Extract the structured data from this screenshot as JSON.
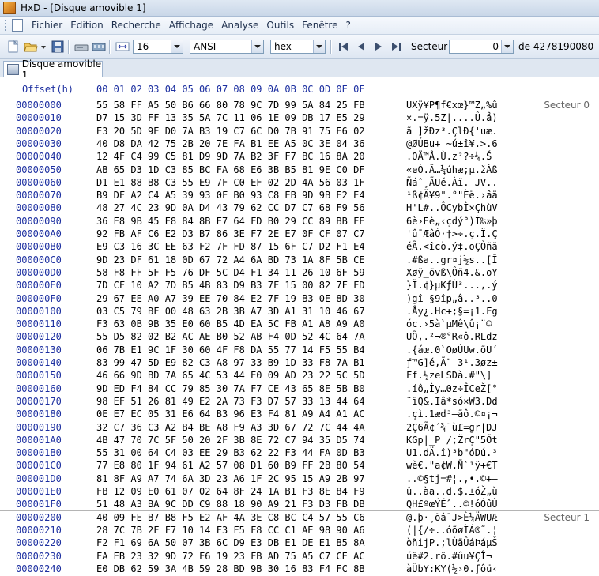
{
  "window": {
    "title": "HxD - [Disque amovible 1]"
  },
  "menu": [
    "Fichier",
    "Edition",
    "Recherche",
    "Affichage",
    "Analyse",
    "Outils",
    "Fenêtre",
    "?"
  ],
  "toolbar": {
    "bytes_per_row": "16",
    "charset": "ANSI",
    "offset_base": "hex",
    "sector_label": "Secteur",
    "sector_value": "0",
    "sector_total": "de 4278190080"
  },
  "tabs": [
    {
      "label": "Disque amovible 1"
    }
  ],
  "hex_header": {
    "offset_label": "Offset(h)",
    "columns": "00 01 02 03 04 05 06 07 08 09 0A 0B 0C 0D 0E 0F"
  },
  "sectors": [
    "Secteur 0",
    "Secteur 1"
  ],
  "rows": [
    {
      "o": "00000000",
      "h": "55 58 FF A5 50 B6 66 80 78 9C 7D 99 5A 84 25 FB",
      "a": "UXÿ¥P¶f€xœ}™Z„%û"
    },
    {
      "o": "00000010",
      "h": "D7 15 3D FF 13 35 5A 7C 11 06 1E 09 DB 17 E5 29",
      "a": "×.=ÿ.5Z|....Û.å)"
    },
    {
      "o": "00000020",
      "h": "E3 20 5D 9E D0 7A B3 19 C7 6C D0 7B 91 75 E6 02",
      "a": "ã ]žÐz³.ÇlÐ{'uæ."
    },
    {
      "o": "00000030",
      "h": "40 D8 DA 42 75 2B 20 7E FA B1 EE A5 0C 3E 04 36",
      "a": "@ØÚBu+ ~ú±î¥.>.6"
    },
    {
      "o": "00000040",
      "h": "12 4F C4 99 C5 81 D9 9D 7A B2 3F F7 BC 16 8A 20",
      "a": ".OÄ™Å.Ù.z²?÷¼.Š "
    },
    {
      "o": "00000050",
      "h": "AB 65 D3 1D C3 85 BC FA 68 E6 3B B5 81 9E C0 DF",
      "a": "«eÓ.Ã…¼úhæ;µ.žÀß"
    },
    {
      "o": "00000060",
      "h": "D1 E1 88 B8 C3 55 E9 7F C0 EF 02 2D 4A 56 03 1F",
      "a": "Ñáˆ¸ÃUé.Àï.-JV.."
    },
    {
      "o": "00000070",
      "h": "B9 DF A2 C4 A5 39 93 0F B0 93 C8 EB 9D 9B E2 E4",
      "a": "¹ß¢Ä¥9\".°\"Èë.›âä"
    },
    {
      "o": "00000080",
      "h": "48 27 4C 23 9D 0A D4 43 79 62 CC D7 C7 68 F9 56",
      "a": "H'L#..ÔCybÌ×ÇhùV"
    },
    {
      "o": "00000090",
      "h": "36 E8 9B 45 E8 84 8B E7 64 FD B0 29 CC 89 BB FE",
      "a": "6è›Eè„‹çdý°)Ì‰»þ"
    },
    {
      "o": "000000A0",
      "h": "92 FB AF C6 E2 D3 B7 86 3E F7 2E E7 0F CF 07 C7",
      "a": "'û¯ÆâÓ·†>÷.ç.Ï.Ç"
    },
    {
      "o": "000000B0",
      "h": "E9 C3 16 3C EE 63 F2 7F FD 87 15 6F C7 D2 F1 E4",
      "a": "éÃ.<îcò.ý‡.oÇÒñä"
    },
    {
      "o": "000000C0",
      "h": "9D 23 DF 61 18 0D 67 72 A4 6A BD 73 1A 8F 5B CE",
      "a": ".#ßa..gr¤j½s..[Î"
    },
    {
      "o": "000000D0",
      "h": "58 F8 FF 5F F5 76 DF 5C D4 F1 34 11 26 10 6F 59",
      "a": "Xøÿ_õvß\\Ôñ4.&.oY"
    },
    {
      "o": "000000E0",
      "h": "7D CF 10 A2 7D B5 4B 83 D9 B3 7F 15 00 82 7F FD",
      "a": "}Ï.¢}µKƒÙ³...‚.ý"
    },
    {
      "o": "000000F0",
      "h": "29 67 EE A0 A7 39 EE 70 84 E2 7F 19 B3 0E 8D 30",
      "a": ")gî §9îp„â..³..0"
    },
    {
      "o": "00000100",
      "h": "03 C5 79 BF 00 48 63 2B 3B A7 3D A1 31 10 46 67",
      "a": ".Åy¿.Hc+;§=¡1.Fg"
    },
    {
      "o": "00000110",
      "h": "F3 63 0B 9B 35 E0 60 B5 4D EA 5C FB A1 A8 A9 A0",
      "a": "óc.›5à`µMê\\û¡¨© "
    },
    {
      "o": "00000120",
      "h": "55 D5 82 02 B2 AC AE B0 52 AB F4 0D 52 4C 64 7A",
      "a": "UÕ‚.²¬®°R«ô.RLdz"
    },
    {
      "o": "00000130",
      "h": "06 7B E1 9C 1F 30 60 4F F8 DA 55 77 14 F5 55 B4",
      "a": ".{áœ.0`OøÚUw.õU´"
    },
    {
      "o": "00000140",
      "h": "83 99 47 5D E9 82 C3 A8 97 33 B9 1D 33 F8 7A B1",
      "a": "ƒ™G]é‚Ã¨—3¹.3øz±"
    },
    {
      "o": "00000150",
      "h": "46 66 9D BD 7A 65 4C 53 44 E0 09 AD 23 22 5C 5D",
      "a": "Ff.½zeLSDà.­#\"\\]"
    },
    {
      "o": "00000160",
      "h": "9D ED F4 84 CC 79 85 30 7A F7 CE 43 65 8E 5B B0",
      "a": ".íô„Ìy…0z÷ÎCeŽ[°"
    },
    {
      "o": "00000170",
      "h": "98 EF 51 26 81 49 E2 2A 73 F3 D7 57 33 13 44 64",
      "a": "˜ïQ&.Iâ*só×W3.Dd"
    },
    {
      "o": "00000180",
      "h": "0E E7 EC 05 31 E6 64 B3 96 E3 F4 81 A9 A4 A1 AC",
      "a": ".çì.1æd³–ãô.©¤¡¬"
    },
    {
      "o": "00000190",
      "h": "32 C7 36 C3 A2 B4 BE A8 F9 A3 3D 67 72 7C 44 4A",
      "a": "2Ç6Ã¢´¾¨ù£=gr|DJ"
    },
    {
      "o": "000001A0",
      "h": "4B 47 70 7C 5F 50 20 2F 3B 8E 72 C7 94 35 D5 74",
      "a": "KGp|_P /;ŽrÇ\"5Õt"
    },
    {
      "o": "000001B0",
      "h": "55 31 00 64 C4 03 EE 29 B3 62 22 F3 44 FA 0D B3",
      "a": "U1.dÄ.î)³b\"óDú.³"
    },
    {
      "o": "000001C0",
      "h": "77 E8 80 1F 94 61 A2 57 08 D1 60 B9 FF 2B 80 54",
      "a": "wè€.\"a¢W.Ñ`¹ÿ+€T"
    },
    {
      "o": "000001D0",
      "h": "81 8F A9 A7 74 6A 3D 23 A6 1F 2C 95 15 A9 2B 97",
      "a": "..©§tj=#¦.,•.©+—"
    },
    {
      "o": "000001E0",
      "h": "FB 12 09 E0 61 07 02 64 8F 24 1A B1 F3 8E 84 F9",
      "a": "û..àa..d.$.±óŽ„ù"
    },
    {
      "o": "000001F0",
      "h": "51 48 A3 BA 9C DD C9 88 18 90 A9 21 F3 D3 FB DB",
      "a": "QH£ºœÝÉˆ..©!óÓûÛ"
    },
    {
      "o": "00000200",
      "h": "40 09 FE B7 B8 F5 E2 AF 4A 3E C8 BC C4 57 55 C6",
      "a": "@.þ·¸õâ¯J>È¼ÄWUÆ"
    },
    {
      "o": "00000210",
      "h": "28 7C 7B 2F F7 10 14 F3 F5 F8 CC C1 AE 98 90 A6",
      "a": "(|{/÷..óõøÌÁ®˜.¦"
    },
    {
      "o": "00000220",
      "h": "F2 F1 69 6A 50 07 3B 6C D9 E3 DB E1 DE E1 B5 8A",
      "a": "òñijP.;lÙãÛáÞáµŠ"
    },
    {
      "o": "00000230",
      "h": "FA EB 23 32 9D 72 F6 19 23 FB AD 75 A5 C7 CE AC",
      "a": "úë#2.rö.#û­u¥ÇÎ¬"
    },
    {
      "o": "00000240",
      "h": "E0 DB 62 59 3A 4B 59 28 BD 9B 30 16 83 F4 FC 8B",
      "a": "àÛbY:KY(½›0.ƒôü‹"
    }
  ]
}
